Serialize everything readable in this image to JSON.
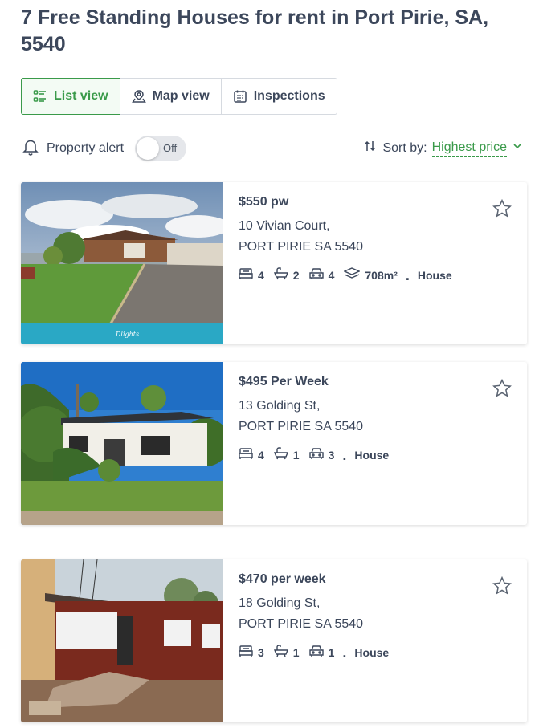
{
  "page_title": "7 Free Standing Houses for rent in Port Pirie, SA, 5540",
  "tabs": [
    {
      "label": "List view",
      "icon": "list-icon",
      "active": true
    },
    {
      "label": "Map view",
      "icon": "map-pin-icon",
      "active": false
    },
    {
      "label": "Inspections",
      "icon": "calendar-icon",
      "active": false
    }
  ],
  "alert": {
    "label": "Property alert",
    "toggle_label": "Off"
  },
  "sort": {
    "label": "Sort by:",
    "value": "Highest price"
  },
  "colors": {
    "accent": "#3a9a4a",
    "text": "#3c475b"
  },
  "listings": [
    {
      "price": "$550 pw",
      "address_line1": "10 Vivian Court,",
      "address_line2": "PORT PIRIE SA 5540",
      "beds": "4",
      "baths": "2",
      "cars": "4",
      "land": "708m²",
      "type": "House",
      "photo_caption": "Dlights"
    },
    {
      "price": "$495 Per Week",
      "address_line1": "13 Golding St,",
      "address_line2": "PORT PIRIE SA 5540",
      "beds": "4",
      "baths": "1",
      "cars": "3",
      "type": "House"
    },
    {
      "price": "$470 per week",
      "address_line1": "18 Golding St,",
      "address_line2": "PORT PIRIE SA 5540",
      "beds": "3",
      "baths": "1",
      "cars": "1",
      "type": "House"
    }
  ]
}
